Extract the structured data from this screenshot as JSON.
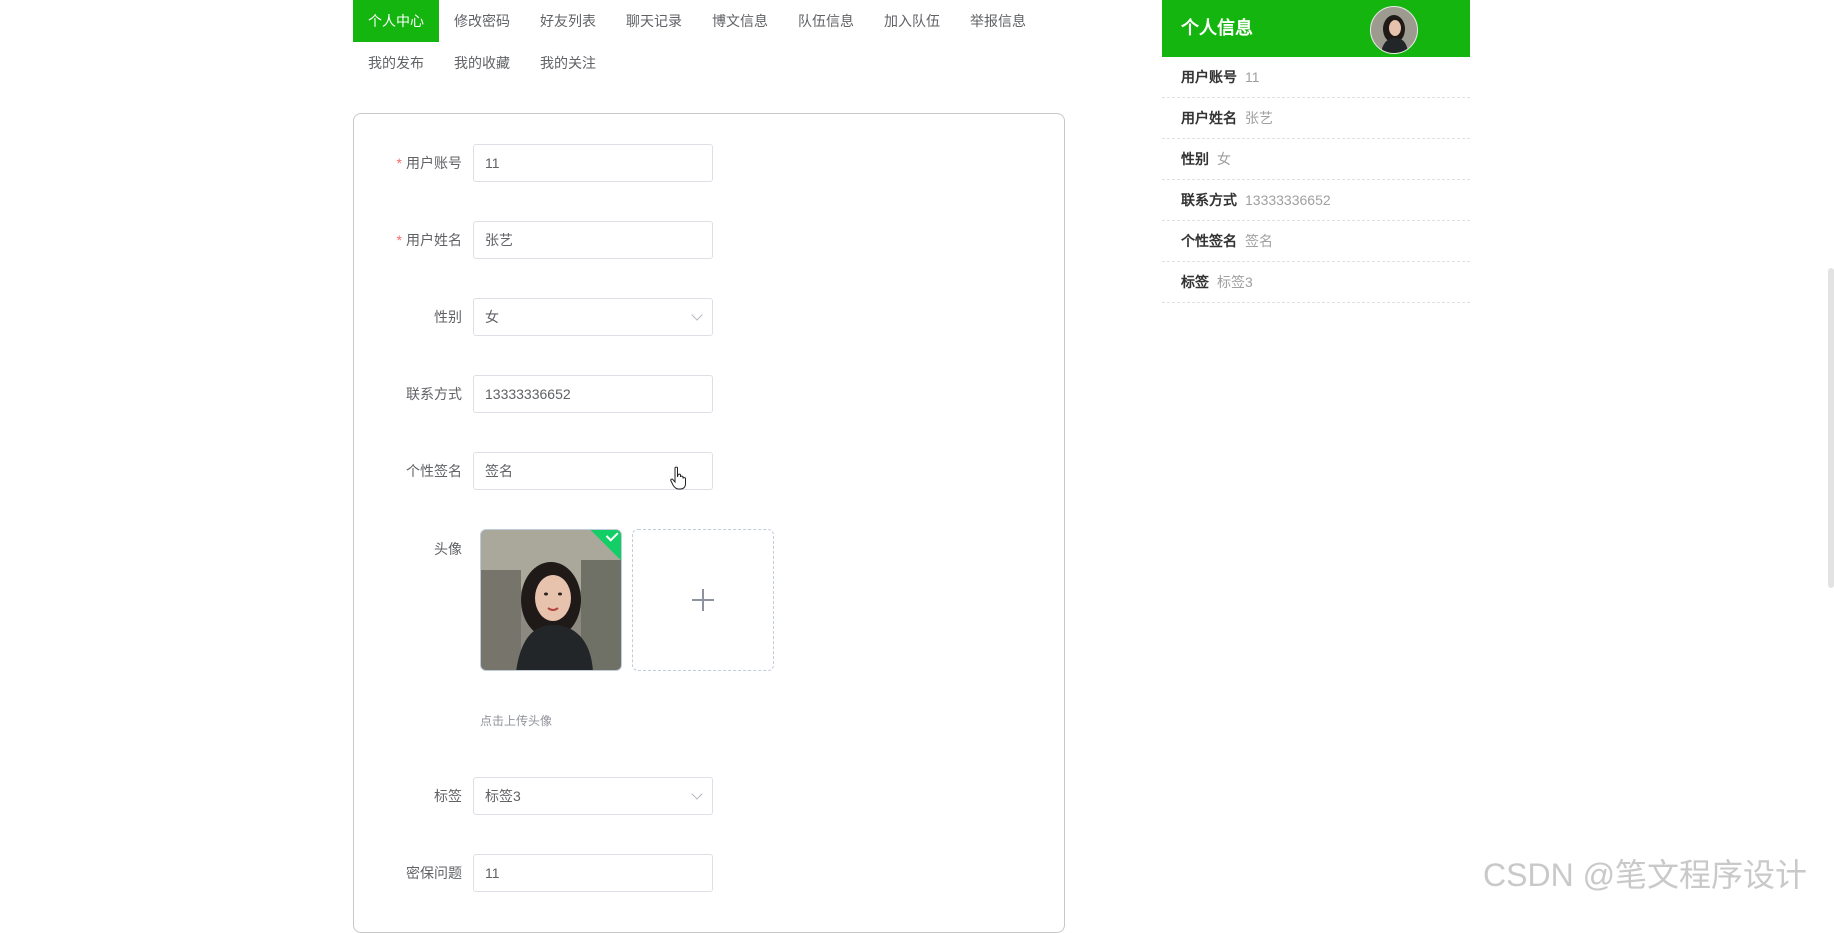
{
  "tabs": {
    "row1": [
      "个人中心",
      "修改密码",
      "好友列表",
      "聊天记录",
      "博文信息",
      "队伍信息",
      "加入队伍",
      "举报信息"
    ],
    "row2": [
      "我的发布",
      "我的收藏",
      "我的关注"
    ],
    "active": "个人中心"
  },
  "form": {
    "account": {
      "label": "用户账号",
      "value": "11"
    },
    "name": {
      "label": "用户姓名",
      "value": "张艺"
    },
    "gender": {
      "label": "性别",
      "value": "女"
    },
    "phone": {
      "label": "联系方式",
      "value": "13333336652"
    },
    "signature": {
      "label": "个性签名",
      "value": "签名"
    },
    "avatar": {
      "label": "头像",
      "tip": "点击上传头像"
    },
    "tag": {
      "label": "标签",
      "value": "标签3"
    },
    "security_question": {
      "label": "密保问题",
      "value": "11"
    },
    "required_mark": "*"
  },
  "panel": {
    "title": "个人信息",
    "rows": [
      {
        "key": "用户账号",
        "value": "11"
      },
      {
        "key": "用户姓名",
        "value": "张艺"
      },
      {
        "key": "性别",
        "value": "女"
      },
      {
        "key": "联系方式",
        "value": "13333336652"
      },
      {
        "key": "个性签名",
        "value": "签名"
      },
      {
        "key": "标签",
        "value": "标签3"
      }
    ]
  },
  "watermark": "CSDN @笔文程序设计",
  "colors": {
    "accent": "#13b50e",
    "success": "#13ce66",
    "required": "#f56c6c"
  },
  "icons": [
    "chevron-down-icon",
    "plus-icon",
    "check-icon",
    "hand-pointer-icon"
  ]
}
